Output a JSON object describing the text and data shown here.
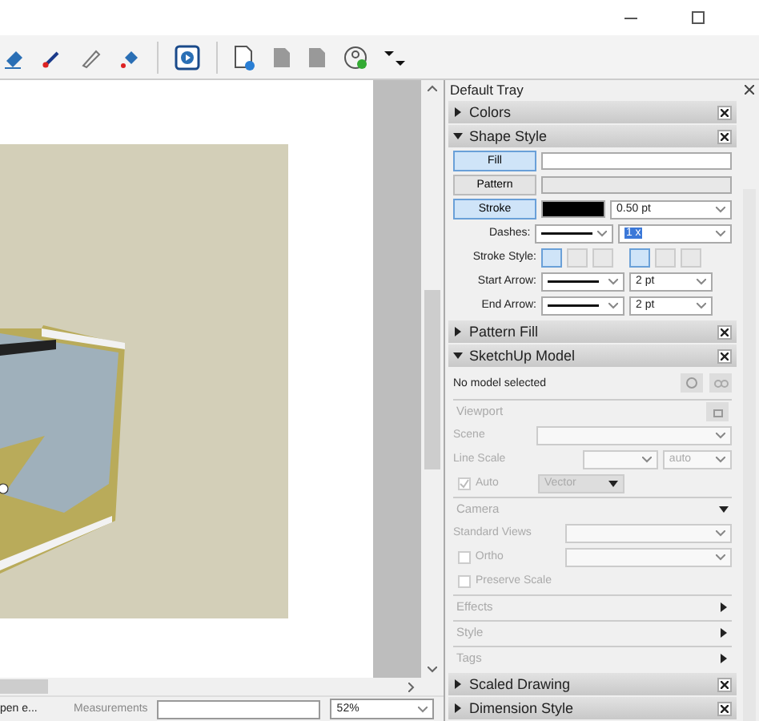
{
  "tray": {
    "title": "Default Tray"
  },
  "panels": [
    {
      "kind": "plain",
      "title": "Colors",
      "expanded": false
    },
    {
      "kind": "shape_style",
      "title": "Shape Style",
      "expanded": true
    },
    {
      "kind": "plain",
      "title": "Pattern Fill",
      "expanded": false
    },
    {
      "kind": "sketchup",
      "title": "SketchUp Model",
      "expanded": true
    },
    {
      "kind": "plain",
      "title": "Scaled Drawing",
      "expanded": false
    },
    {
      "kind": "plain",
      "title": "Dimension Style",
      "expanded": false
    }
  ],
  "shape_style": {
    "fill": {
      "label": "Fill",
      "selected": true
    },
    "pattern": {
      "label": "Pattern",
      "selected": false
    },
    "stroke": {
      "label": "Stroke",
      "selected": true,
      "weight": "0.50 pt"
    },
    "dashes": {
      "label": "Dashes:",
      "scale": "1 x"
    },
    "stroke_style": {
      "label": "Stroke Style:"
    },
    "start_arrow": {
      "label": "Start Arrow:",
      "size": "2 pt"
    },
    "end_arrow": {
      "label": "End Arrow:",
      "size": "2 pt"
    }
  },
  "sketchup": {
    "status": "No model selected",
    "viewport": {
      "title": "Viewport",
      "scene": "Scene",
      "line_scale": "Line Scale",
      "line_scale_value": "auto",
      "auto": {
        "label": "Auto",
        "checked": true
      },
      "render": "Vector"
    },
    "camera": {
      "title": "Camera",
      "standard_views": "Standard Views",
      "ortho": {
        "label": "Ortho",
        "checked": false
      },
      "preserve": {
        "label": "Preserve Scale",
        "checked": false
      }
    },
    "sections": [
      "Effects",
      "Style",
      "Tags"
    ]
  },
  "status_bar": {
    "hint": "pen e...",
    "measurements": "Measurements",
    "zoom": "52%"
  }
}
